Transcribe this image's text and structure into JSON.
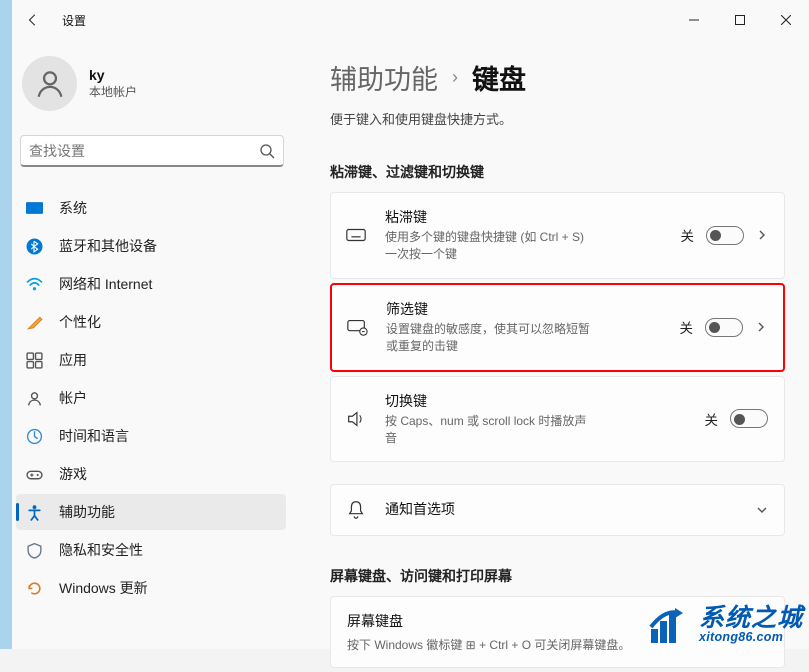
{
  "window": {
    "title": "设置"
  },
  "user": {
    "name": "ky",
    "sub": "本地帐户"
  },
  "search": {
    "placeholder": "查找设置"
  },
  "nav": {
    "items": [
      {
        "label": "系统"
      },
      {
        "label": "蓝牙和其他设备"
      },
      {
        "label": "网络和 Internet"
      },
      {
        "label": "个性化"
      },
      {
        "label": "应用"
      },
      {
        "label": "帐户"
      },
      {
        "label": "时间和语言"
      },
      {
        "label": "游戏"
      },
      {
        "label": "辅助功能"
      },
      {
        "label": "隐私和安全性"
      },
      {
        "label": "Windows 更新"
      }
    ]
  },
  "breadcrumb": {
    "parent": "辅助功能",
    "sep": "›",
    "current": "键盘"
  },
  "subtitle": "便于键入和使用键盘快捷方式。",
  "section1": {
    "heading": "粘滞键、过滤键和切换键",
    "sticky": {
      "title": "粘滞键",
      "desc": "使用多个键的键盘快捷键 (如 Ctrl + S) 一次按一个键",
      "state": "关"
    },
    "filter": {
      "title": "筛选键",
      "desc": "设置键盘的敏感度，使其可以忽略短暂或重复的击键",
      "state": "关"
    },
    "toggle": {
      "title": "切换键",
      "desc": "按 Caps、num 或 scroll lock 时播放声音",
      "state": "关"
    },
    "notify": {
      "title": "通知首选项"
    }
  },
  "section2": {
    "heading": "屏幕键盘、访问键和打印屏幕",
    "osk": {
      "title": "屏幕键盘",
      "desc": "按下 Windows 徽标键 ⊞ + Ctrl + O 可关闭屏幕键盘。"
    }
  },
  "watermark": {
    "big": "系统之城",
    "small": "xitong86.com"
  }
}
